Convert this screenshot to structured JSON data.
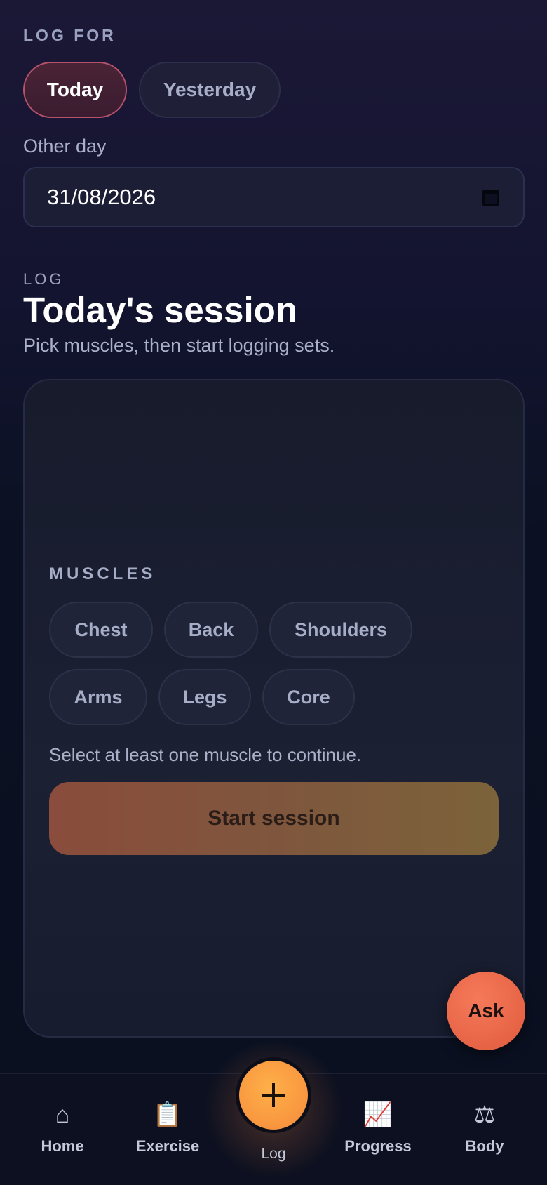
{
  "log_for": {
    "label": "LOG FOR",
    "options": [
      {
        "label": "Today",
        "active": true
      },
      {
        "label": "Yesterday",
        "active": false
      }
    ],
    "other_day_label": "Other day",
    "date_value": "31/08/2026"
  },
  "header": {
    "eyebrow": "LOG",
    "title": "Today's session",
    "subtitle": "Pick muscles, then start logging sets."
  },
  "muscles": {
    "label": "MUSCLES",
    "chips": [
      "Chest",
      "Back",
      "Shoulders",
      "Arms",
      "Legs",
      "Core"
    ],
    "hint": "Select at least one muscle to continue.",
    "start_label": "Start session"
  },
  "ask_label": "Ask",
  "nav": {
    "items": [
      {
        "label": "Home",
        "icon": "home-icon"
      },
      {
        "label": "Exercise",
        "icon": "clipboard-icon"
      },
      {
        "label": "Log",
        "icon": "plus-icon"
      },
      {
        "label": "Progress",
        "icon": "chart-icon"
      },
      {
        "label": "Body",
        "icon": "scale-icon"
      }
    ]
  },
  "colors": {
    "accent": "#f58a3a",
    "active_pill_border": "#b5526a",
    "ask_button": "#e05a3c"
  }
}
